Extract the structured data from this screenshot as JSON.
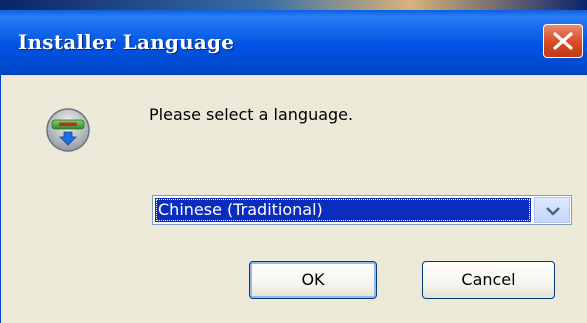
{
  "dialog": {
    "title": "Installer Language",
    "prompt": "Please select a language.",
    "icon": "installer-icon"
  },
  "language_select": {
    "selected": "Chinese (Traditional)"
  },
  "buttons": {
    "ok_label": "OK",
    "cancel_label": "Cancel"
  },
  "colors": {
    "titlebar": "#0054e3",
    "close_button": "#d84a22",
    "selection": "#0b2dbd",
    "window_bg": "#ece9d8"
  }
}
